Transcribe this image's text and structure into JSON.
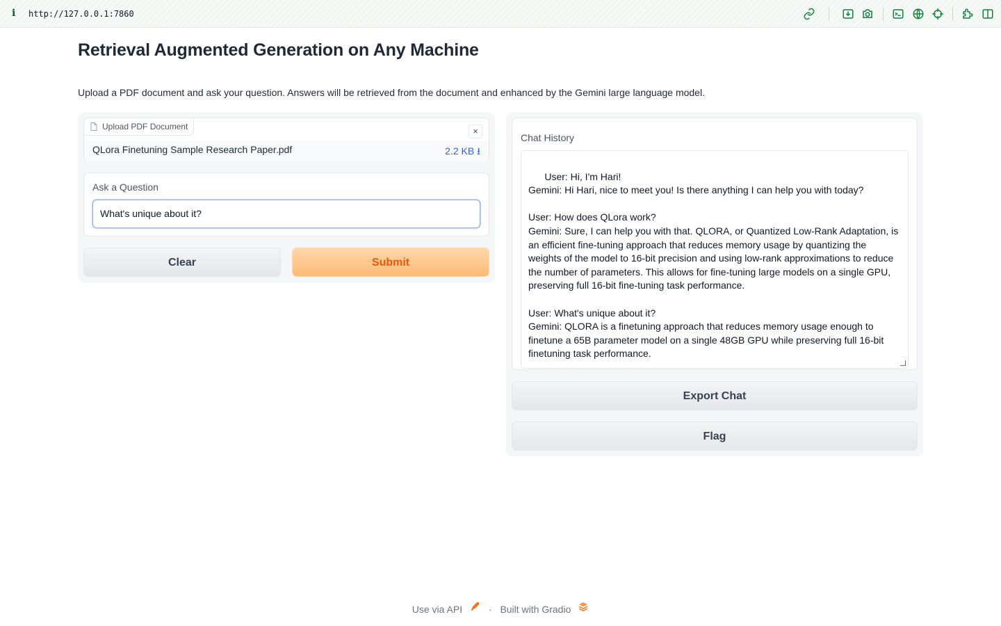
{
  "browser": {
    "info_glyph": "i",
    "url": "http://127.0.0.1:7860",
    "toolbar_icons": [
      "link-icon",
      "download-icon",
      "camera-icon",
      "terminal-icon",
      "globe-icon",
      "crosshair-icon",
      "extension-icon",
      "split-view-icon"
    ]
  },
  "page": {
    "title": "Retrieval Augmented Generation on Any Machine",
    "description": "Upload a PDF document and ask your question. Answers will be retrieved from the document and enhanced by the Gemini large language model."
  },
  "upload": {
    "label": "Upload PDF Document",
    "file_name": "QLora Finetuning Sample Research Paper.pdf",
    "file_size": "2.2 KB ⭳",
    "close_glyph": "×"
  },
  "question": {
    "label": "Ask a Question",
    "value": "What's unique about it?"
  },
  "buttons": {
    "clear": "Clear",
    "submit": "Submit",
    "export": "Export Chat",
    "flag": "Flag"
  },
  "chat": {
    "label": "Chat History",
    "text": "User: Hi, I'm Hari!\nGemini: Hi Hari, nice to meet you! Is there anything I can help you with today?\n\nUser: How does QLora work?\nGemini: Sure, I can help you with that. QLORA, or Quantized Low-Rank Adaptation, is an efficient fine-tuning approach that reduces memory usage by quantizing the weights of the model to 16-bit precision and using low-rank approximations to reduce the number of parameters. This allows for fine-tuning large models on a single GPU, preserving full 16-bit fine-tuning task performance.\n\nUser: What's unique about it?\nGemini: QLORA is a finetuning approach that reduces memory usage enough to finetune a 65B parameter model on a single 48GB GPU while preserving full 16-bit finetuning task performance."
  },
  "footer": {
    "api": "Use via API",
    "separator": "·",
    "built": "Built with Gradio"
  },
  "colors": {
    "accent": "#ea580c",
    "primary_button": "#fdba74",
    "link": "#2563eb",
    "browser_icons": "#15803d"
  }
}
